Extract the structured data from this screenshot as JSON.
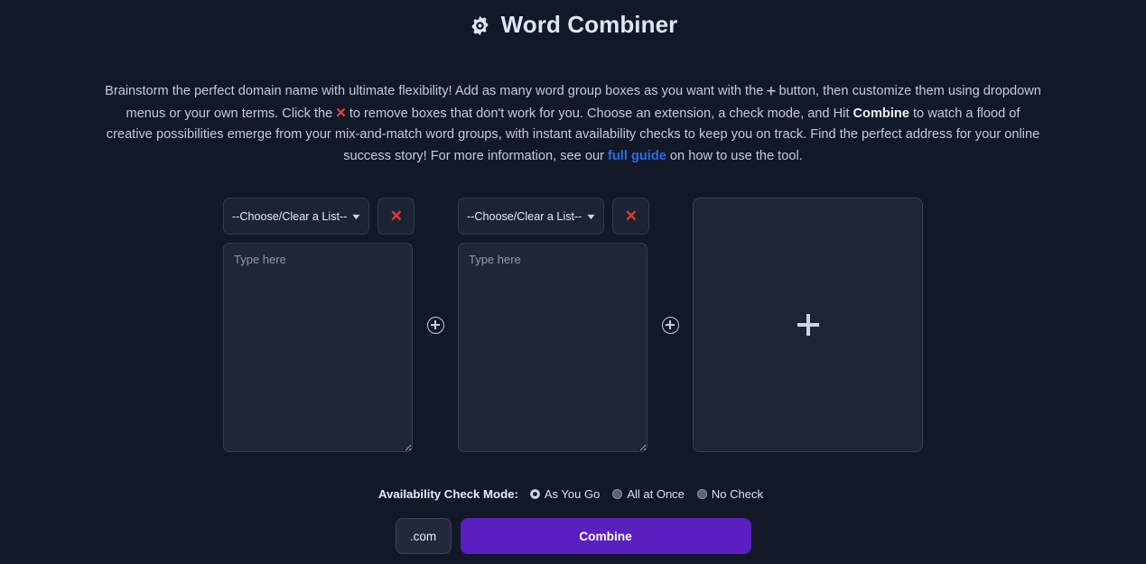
{
  "header": {
    "icon": "gear-icon",
    "title": "Word Combiner"
  },
  "description": {
    "part1": "Brainstorm the perfect domain name with ultimate flexibility! Add as many word group boxes as you want with the",
    "plus_symbol": "+",
    "part2": "button, then customize them using dropdown menus or your own terms. Click the",
    "x_symbol": "✕",
    "part3": "to remove boxes that don't work for you. Choose an extension, a check mode, and Hit",
    "bold_combine": "Combine",
    "part4": "to watch a flood of creative possibilities emerge from your mix-and-match word groups, with instant availability checks to keep you on track. Find the perfect address for your online success story! For more information, see our",
    "link_text": "full guide",
    "part5": "on how to use the tool."
  },
  "groups": [
    {
      "select_value": "--Choose/Clear a List--",
      "remove_label": "✕",
      "textarea_value": "",
      "textarea_placeholder": "Type here"
    },
    {
      "select_value": "--Choose/Clear a List--",
      "remove_label": "✕",
      "textarea_value": "",
      "textarea_placeholder": "Type here"
    }
  ],
  "add_box": {
    "icon": "plus-icon"
  },
  "connector": {
    "icon": "circle-plus-icon"
  },
  "check_mode": {
    "label": "Availability Check Mode:",
    "options": [
      {
        "label": "As You Go",
        "selected": true
      },
      {
        "label": "All at Once",
        "selected": false
      },
      {
        "label": "No Check",
        "selected": false
      }
    ]
  },
  "actions": {
    "extension_value": ".com",
    "combine_label": "Combine"
  },
  "colors": {
    "page_background": "#111827",
    "card_background": "#1e2738",
    "accent_purple": "#5a1fbf",
    "link_blue": "#2f6ae8",
    "danger_red": "#e23b2e",
    "text_primary": "#dfe6f3"
  }
}
